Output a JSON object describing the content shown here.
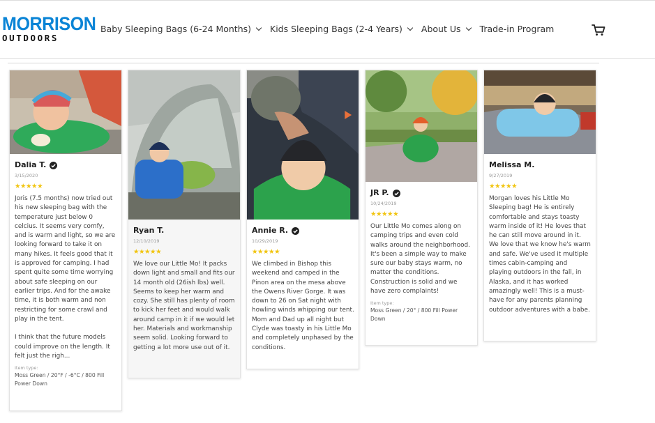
{
  "brand": {
    "name_top": "MORRISON",
    "name_bottom": "OUTDOORS",
    "color": "#0a84d6"
  },
  "nav": {
    "items": [
      {
        "label": "Baby Sleeping Bags (6-24 Months)",
        "dropdown": true
      },
      {
        "label": "Kids Sleeping Bags (2-4 Years)",
        "dropdown": true
      },
      {
        "label": "About Us",
        "dropdown": true
      },
      {
        "label": "Trade-in Program",
        "dropdown": false
      }
    ],
    "cart_icon": "cart-icon"
  },
  "colors": {
    "star": "#f1c40f",
    "text": "#444444",
    "muted": "#9a9a9a"
  },
  "reviews": [
    {
      "author": "Dalia T.",
      "verified": true,
      "date": "3/15/2020",
      "rating": 5,
      "text": "Joris (7.5 months) now tried out his new sleeping bag with the temperature just below 0 celcius. It seems very comfy, and is warm and light, so we are looking forward to take it on many hikes. It feels good that it is approved for camping. I had spent quite some time worrying about safe sleeping on our earlier trips. And for the awake time, it is both warm and non restricting for some crawl and play in the tent.\n\nI think that the future models could improve on the length. It felt just the righ...",
      "item_type_label": "Item type:",
      "item_type": "Moss Green / 20°F / -6°C / 800 Fill Power Down"
    },
    {
      "author": "Ryan T.",
      "verified": false,
      "date": "12/10/2019",
      "rating": 5,
      "text": "We love our Little Mo! It packs down light and small and fits our 14 month old (26ish lbs) well. Seems to keep her warm and cozy. She still has plenty of room to kick her feet and would walk around camp in it if we would let her. Materials and workmanship seem solid. Looking forward to getting a lot more use out of it."
    },
    {
      "author": "Annie R.",
      "verified": true,
      "date": "10/29/2019",
      "rating": 5,
      "text": "We climbed in Bishop this weekend and camped in the Pinon area on the mesa above the Owens River Gorge. It was down to 26 on Sat night with howling winds whipping our tent. Mom and Dad up all night but Clyde was toasty in his Little Mo and completely unphased by the conditions."
    },
    {
      "author": "JR P.",
      "verified": true,
      "date": "10/24/2019",
      "rating": 5,
      "text": "Our Little Mo comes along on camping trips and even cold walks around the neighborhood. It's been a simple way to make sure our baby stays warm, no matter the conditions. Construction is solid and we have zero complaints!",
      "item_type_label": "Item type:",
      "item_type": "Moss Green / 20° / 800 Fill Power Down"
    },
    {
      "author": "Melissa M.",
      "verified": false,
      "date": "9/27/2019",
      "rating": 5,
      "text": "Morgan loves his Little Mo Sleeping bag! He is entirely comfortable and stays toasty warm inside of it! He loves that he can still move around in it. We love that we know he's warm and safe. We've used it multiple times cabin-camping and playing outdoors in the fall, in Alaska, and it has worked amazingly well! This is a must-have for any parents planning outdoor adventures with a babe."
    }
  ]
}
